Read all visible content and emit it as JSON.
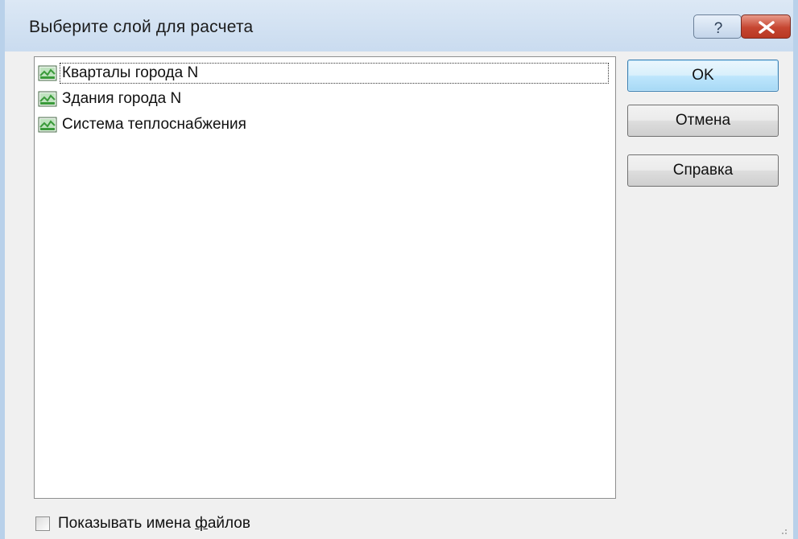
{
  "window": {
    "title": "Выберите слой для расчета",
    "help_icon": "question-mark-icon",
    "close_icon": "close-x-icon"
  },
  "layers": [
    {
      "label": "Кварталы города N",
      "icon": "map-layer-icon",
      "selected": true
    },
    {
      "label": "Здания города N",
      "icon": "map-layer-icon",
      "selected": false
    },
    {
      "label": "Система теплоснабжения",
      "icon": "map-layer-icon",
      "selected": false
    }
  ],
  "buttons": {
    "ok": "OK",
    "cancel": "Отмена",
    "help": "Справка"
  },
  "options": {
    "show_file_names_before": "Показывать имена ",
    "show_file_names_accel": "ф",
    "show_file_names_after": "айлов",
    "show_file_names_checked": false
  },
  "colors": {
    "title_bar": "#c9dbef",
    "close_button": "#c64631",
    "default_button_border": "#3c7fb1",
    "layer_icon_green": "#3a9a3a"
  }
}
